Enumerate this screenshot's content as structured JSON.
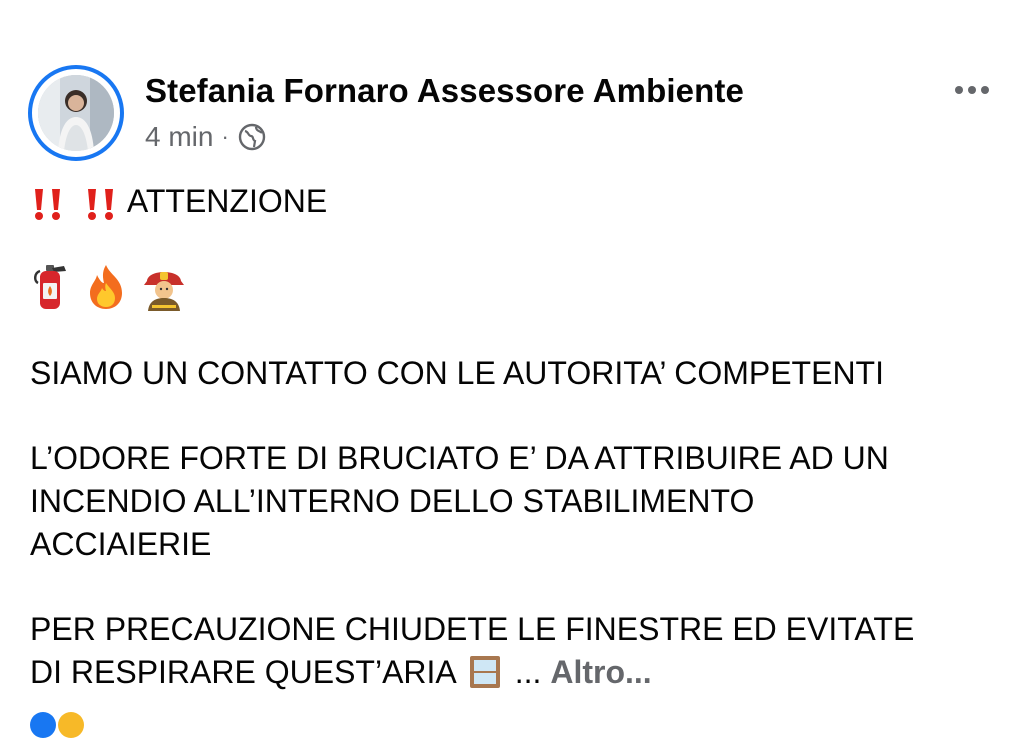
{
  "post": {
    "author": "Stefania Fornaro Assessore Ambiente",
    "time": "4 min",
    "separator": "·",
    "privacy_icon": "globe-icon",
    "more_icon": "ellipsis-icon",
    "headline": "ATTENZIONE",
    "headline_icons": [
      "double-exclamation-icon",
      "double-exclamation-icon"
    ],
    "emoji_row": [
      "fire-extinguisher-icon",
      "fire-icon",
      "firefighter-icon"
    ],
    "paragraphs": [
      [
        "SIAMO UN CONTATTO CON LE AUTORITA’ COMPETENTI"
      ],
      [
        "L’ODORE FORTE DI BRUCIATO E’ DA ATTRIBUIRE AD UN",
        "INCENDIO ALL’INTERNO DELLO STABILIMENTO",
        "ACCIAIERIE"
      ],
      [
        "PER PRECAUZIONE CHIUDETE LE FINESTRE ED EVITATE",
        "DI RESPIRARE QUEST’ARIA"
      ]
    ],
    "window_icon": "window-icon",
    "ellipsis_text": "...",
    "see_more_label": "Altro...",
    "reaction_icons": [
      "like-icon",
      "love-icon"
    ]
  },
  "colors": {
    "accent": "#1877f2",
    "secondary_text": "#65676b",
    "primary_text": "#050505",
    "exclamation": "#e0201b"
  }
}
